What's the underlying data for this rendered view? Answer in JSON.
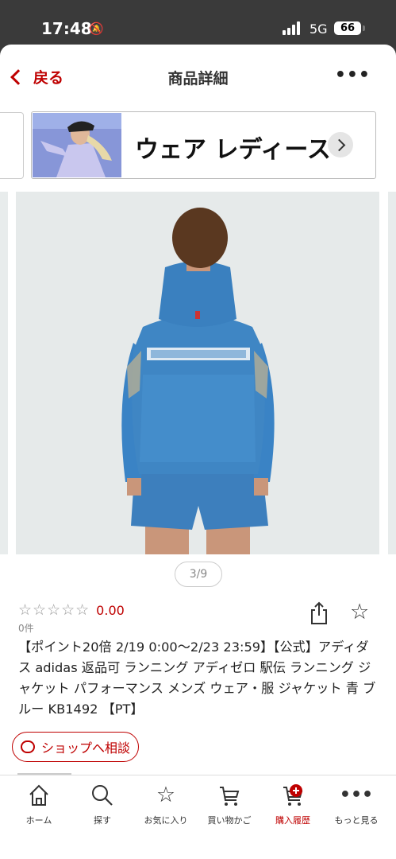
{
  "status": {
    "time": "17:48",
    "network": "5G",
    "battery": "66"
  },
  "nav": {
    "back_label": "戻る",
    "title": "商品詳細",
    "more_label": "•••"
  },
  "banner": {
    "label": "ウェア レディース"
  },
  "image": {
    "counter": "3/9"
  },
  "rating": {
    "stars": "☆☆☆☆☆",
    "value": "0.00",
    "count": "0件"
  },
  "product": {
    "title": "【ポイント20倍 2/19 0:00〜2/23 23:59】【公式】アディダス adidas 返品可 ランニング アディゼロ 駅伝 ランニング ジャケット パフォーマンス メンズ ウェア・服 ジャケット 青 ブルー KB1492 【PT】"
  },
  "consult": {
    "label": "ショップへ相談"
  },
  "tabs": [
    {
      "label": "ホーム",
      "icon": "home-icon"
    },
    {
      "label": "探す",
      "icon": "search-icon"
    },
    {
      "label": "お気に入り",
      "icon": "star-icon"
    },
    {
      "label": "買い物かご",
      "icon": "cart-icon"
    },
    {
      "label": "購入履歴",
      "icon": "purchase-history-icon"
    },
    {
      "label": "もっと見る",
      "icon": "more-icon"
    }
  ],
  "colors": {
    "accent": "#bf0000",
    "jacket": "#3f86c4"
  }
}
